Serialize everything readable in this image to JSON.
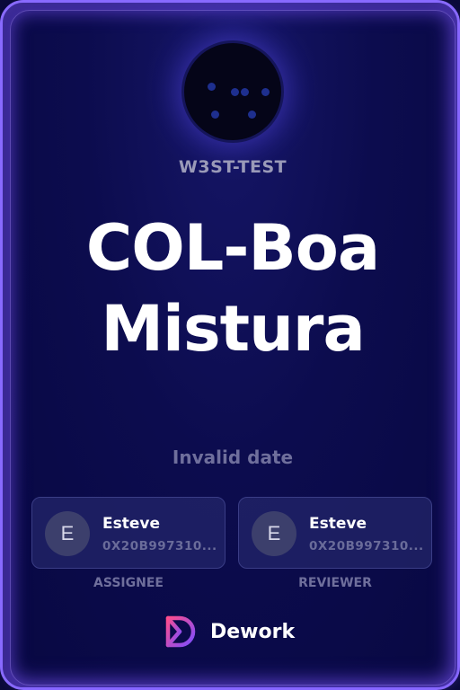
{
  "organization": {
    "name": "W3ST-TEST",
    "avatar_icon": "org-avatar-icon"
  },
  "task": {
    "title": "COL-Boa Mistura",
    "date": "Invalid date"
  },
  "assignee": {
    "initial": "E",
    "name": "Esteve",
    "address": "0X20B997310...",
    "role_label": "ASSIGNEE"
  },
  "reviewer": {
    "initial": "E",
    "name": "Esteve",
    "address": "0X20B997310...",
    "role_label": "REVIEWER"
  },
  "brand": {
    "name": "Dework",
    "logo_icon": "dework-logo-icon"
  },
  "colors": {
    "background": "#0c0c4e",
    "border_glow": "#8a6cff",
    "title_text": "#ffffff",
    "muted_text": "#6f6f9c",
    "logo_gradient_start": "#ff4d8d",
    "logo_gradient_end": "#7b4dff"
  }
}
